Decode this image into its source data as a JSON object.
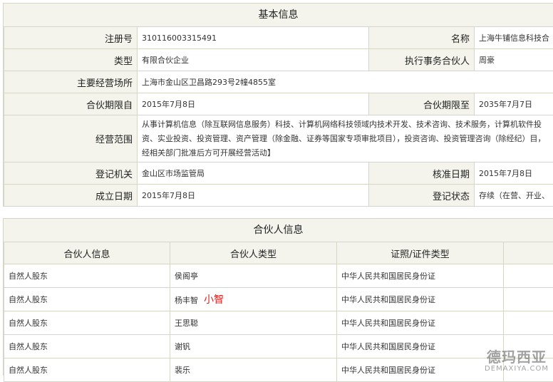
{
  "basic": {
    "title": "基本信息",
    "reg_no_label": "注册号",
    "reg_no": "310116003315491",
    "name_label": "名称",
    "name": "上海牛铺信息科技合",
    "type_label": "类型",
    "type": "有限合伙企业",
    "exec_partner_label": "执行事务合伙人",
    "exec_partner": "周豪",
    "address_label": "主要经营场所",
    "address": "上海市金山区卫昌路293号2幢4855室",
    "term_from_label": "合伙期限自",
    "term_from": "2015年7月8日",
    "term_to_label": "合伙期限至",
    "term_to": "2035年7月7日",
    "scope_label": "经营范围",
    "scope": "从事计算机信息（除互联网信息服务）科技、计算机网络科技领域内技术开发、技术咨询、技术服务，计算机软件投资、实业投资、投资管理、资产管理（除金融、证券等国家专项审批项目），投资咨询、投资管理咨询（除经纪）目，经相关部门批准后方可开展经营活动】",
    "authority_label": "登记机关",
    "authority": "金山区市场监管局",
    "approval_date_label": "核准日期",
    "approval_date": "2015年7月8日",
    "established_label": "成立日期",
    "established": "2015年7月8日",
    "status_label": "登记状态",
    "status": "存续（在营、开业、"
  },
  "partners": {
    "title": "合伙人信息",
    "headers": [
      "合伙人信息",
      "合伙人类型",
      "证照/证件类型"
    ],
    "rows": [
      {
        "info": "自然人股东",
        "name": "侯阁亭",
        "nick": "",
        "id_type": "中华人民共和国居民身份证"
      },
      {
        "info": "自然人股东",
        "name": "杨丰智",
        "nick": "小智",
        "id_type": "中华人民共和国居民身份证"
      },
      {
        "info": "自然人股东",
        "name": "王思聪",
        "nick": "",
        "id_type": "中华人民共和国居民身份证"
      },
      {
        "info": "自然人股东",
        "name": "谢钒",
        "nick": "",
        "id_type": "中华人民共和国居民身份证"
      },
      {
        "info": "自然人股东",
        "name": "裴乐",
        "nick": "",
        "id_type": "中华人民共和国居民身份证"
      }
    ]
  },
  "watermark": {
    "cn": "德玛西亚",
    "en": "DEMAXIYA.COM"
  }
}
